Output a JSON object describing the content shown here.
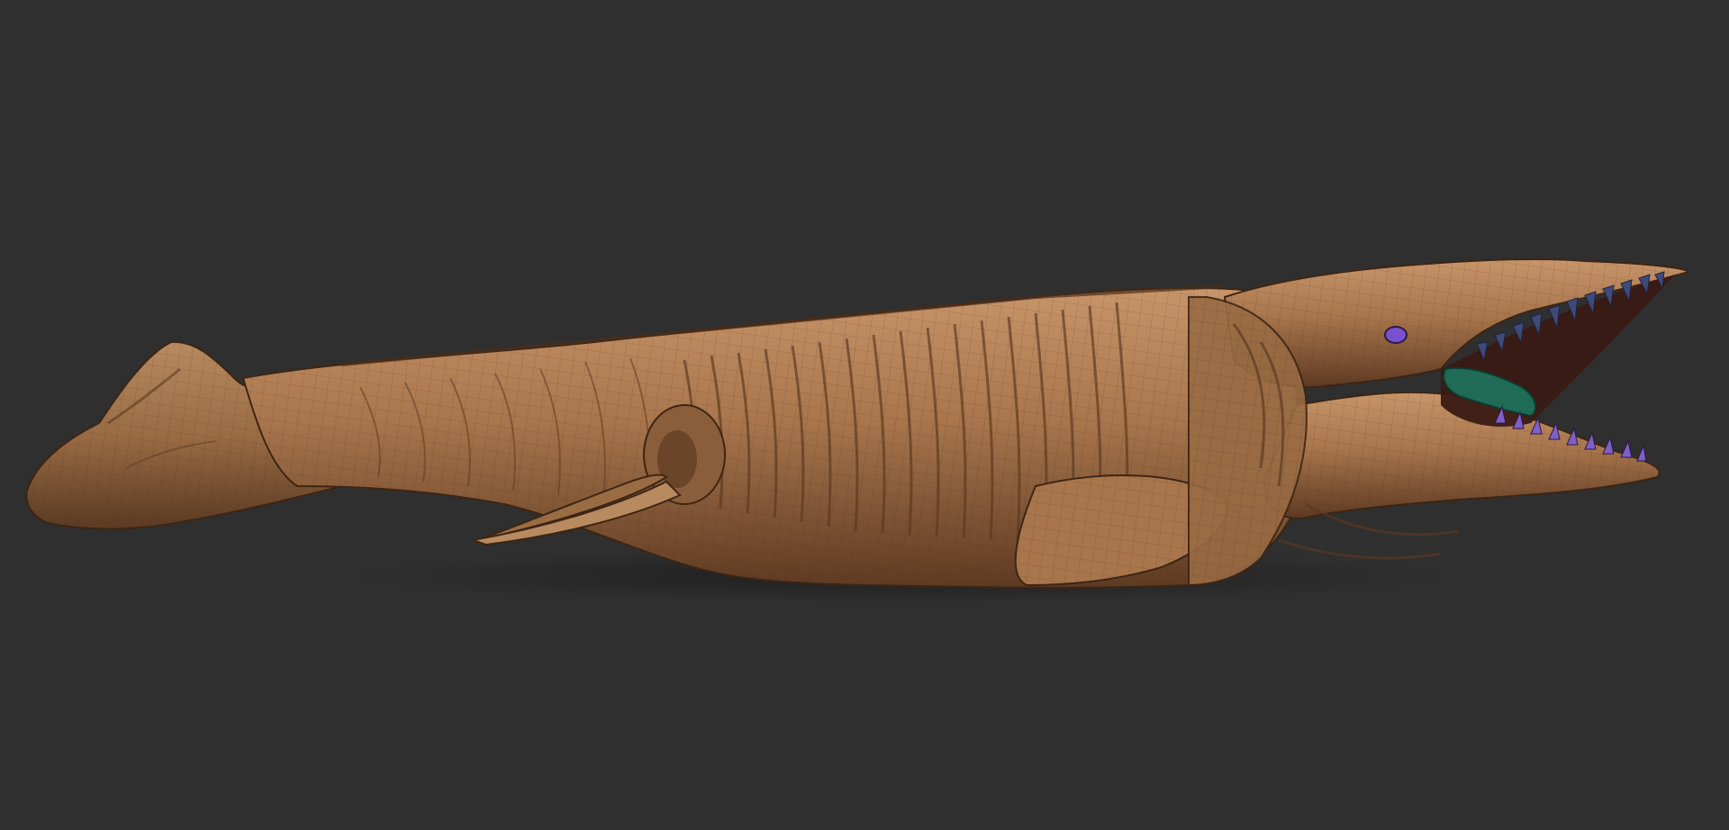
{
  "viewport": {
    "background": "#2f2f2f"
  },
  "model": {
    "icon": "sea-creature-sculpt",
    "skin_color": "#a8754c",
    "skin_highlight": "#c8956a",
    "skin_shadow": "#5e3a22",
    "teeth_color": "#3f4a78",
    "tongue_color": "#1f6b56",
    "eye_color": "#7a4fd0",
    "lower_teeth_color": "#7f5fc8"
  }
}
